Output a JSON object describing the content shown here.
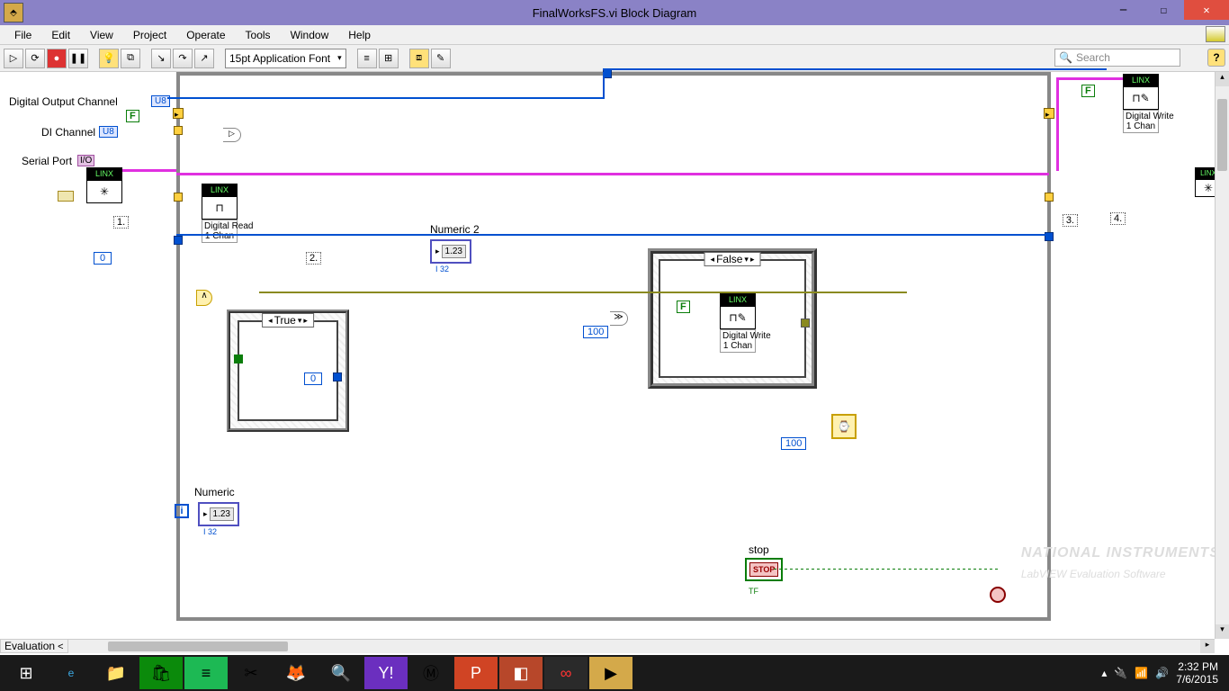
{
  "titlebar": {
    "title": "FinalWorksFS.vi Block Diagram"
  },
  "menu": {
    "file": "File",
    "edit": "Edit",
    "view": "View",
    "project": "Project",
    "operate": "Operate",
    "tools": "Tools",
    "window": "Window",
    "help": "Help"
  },
  "toolbar": {
    "font": "15pt Application Font",
    "search_placeholder": "Search",
    "help": "?"
  },
  "labels": {
    "do_channel": "Digital Output Channel",
    "di_channel": "DI Channel",
    "serial_port": "Serial Port",
    "numeric2": "Numeric 2",
    "numeric": "Numeric",
    "stop": "stop"
  },
  "nodes": {
    "linx": "LINX",
    "digital_read": "Digital Read\n1 Chan",
    "digital_write": "Digital Write\n1 Chan",
    "u8": "U8",
    "io": "I/O",
    "num_display": "1.23",
    "i32": "I 32",
    "stop_text": "STOP"
  },
  "consts": {
    "zero": "0",
    "hundred": "100",
    "true": "True",
    "false": "False",
    "F": "F",
    "TF": "TF"
  },
  "case": {
    "true": "True",
    "false": "False"
  },
  "steps": {
    "s1": "1.",
    "s2": "2.",
    "s3": "3.",
    "s4": "4."
  },
  "loop_i": "i",
  "gate": "∧",
  "status": "Evaluation",
  "watermark": {
    "brand": "NATIONAL INSTRUMENTS",
    "tag": "LabVIEW Evaluation Software"
  },
  "system": {
    "time": "2:32 PM",
    "date": "7/6/2015"
  }
}
